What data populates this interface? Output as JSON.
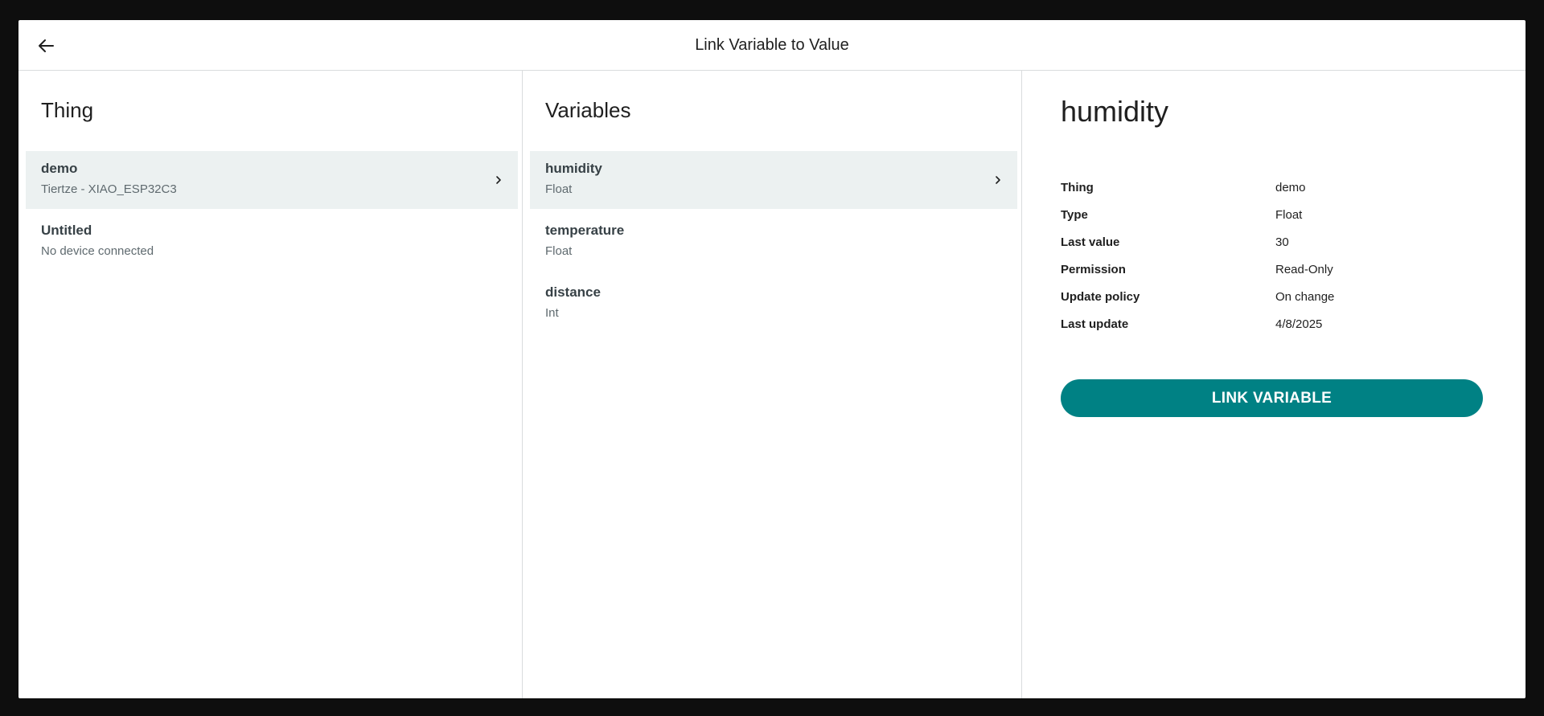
{
  "dialog": {
    "title": "Link Variable to Value"
  },
  "thing_column": {
    "heading": "Thing",
    "items": [
      {
        "name": "demo",
        "sub": "Tiertze - XIAO_ESP32C3",
        "selected": true
      },
      {
        "name": "Untitled",
        "sub": "No device connected",
        "selected": false
      }
    ]
  },
  "variables_column": {
    "heading": "Variables",
    "items": [
      {
        "name": "humidity",
        "sub": "Float",
        "selected": true
      },
      {
        "name": "temperature",
        "sub": "Float",
        "selected": false
      },
      {
        "name": "distance",
        "sub": "Int",
        "selected": false
      }
    ]
  },
  "detail": {
    "title": "humidity",
    "rows": [
      {
        "label": "Thing",
        "value": "demo"
      },
      {
        "label": "Type",
        "value": "Float"
      },
      {
        "label": "Last value",
        "value": "30"
      },
      {
        "label": "Permission",
        "value": "Read-Only"
      },
      {
        "label": "Update policy",
        "value": "On change"
      },
      {
        "label": "Last update",
        "value": "4/8/2025"
      }
    ],
    "button_label": "LINK VARIABLE"
  },
  "colors": {
    "accent": "#008184",
    "selected_row": "#ecf1f1"
  },
  "icons": {
    "back": "arrow-left-icon",
    "chevron": "chevron-right-icon"
  }
}
